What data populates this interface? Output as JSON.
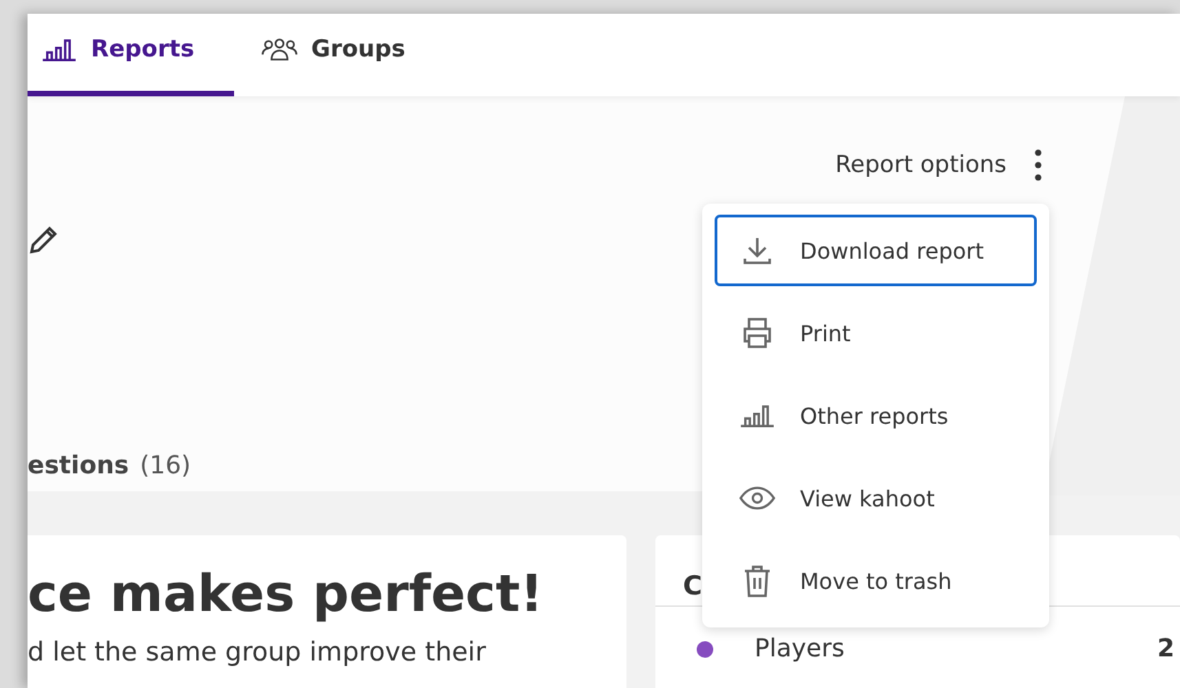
{
  "tabs": [
    {
      "label": "Reports",
      "kind": "bars",
      "selected": true
    },
    {
      "label": "Groups",
      "kind": "people",
      "selected": false
    }
  ],
  "header": {
    "options_label": "Report options"
  },
  "options_menu": [
    {
      "label": "Download report",
      "kind": "download",
      "selected": true
    },
    {
      "label": "Print",
      "kind": "printer",
      "selected": false
    },
    {
      "label": "Other reports",
      "kind": "bars",
      "selected": false
    },
    {
      "label": "View kahoot",
      "kind": "eye",
      "selected": false
    },
    {
      "label": "Move to trash",
      "kind": "trash",
      "selected": false
    }
  ],
  "section_tab": {
    "label": "estions",
    "count": "(16)"
  },
  "left_card": {
    "heading": "ce makes perfect!",
    "text": "d let the same group improve their"
  },
  "right_card": {
    "title": "C",
    "rows": [
      {
        "label": "Players",
        "value": "2",
        "color": "#864cbf"
      }
    ]
  }
}
